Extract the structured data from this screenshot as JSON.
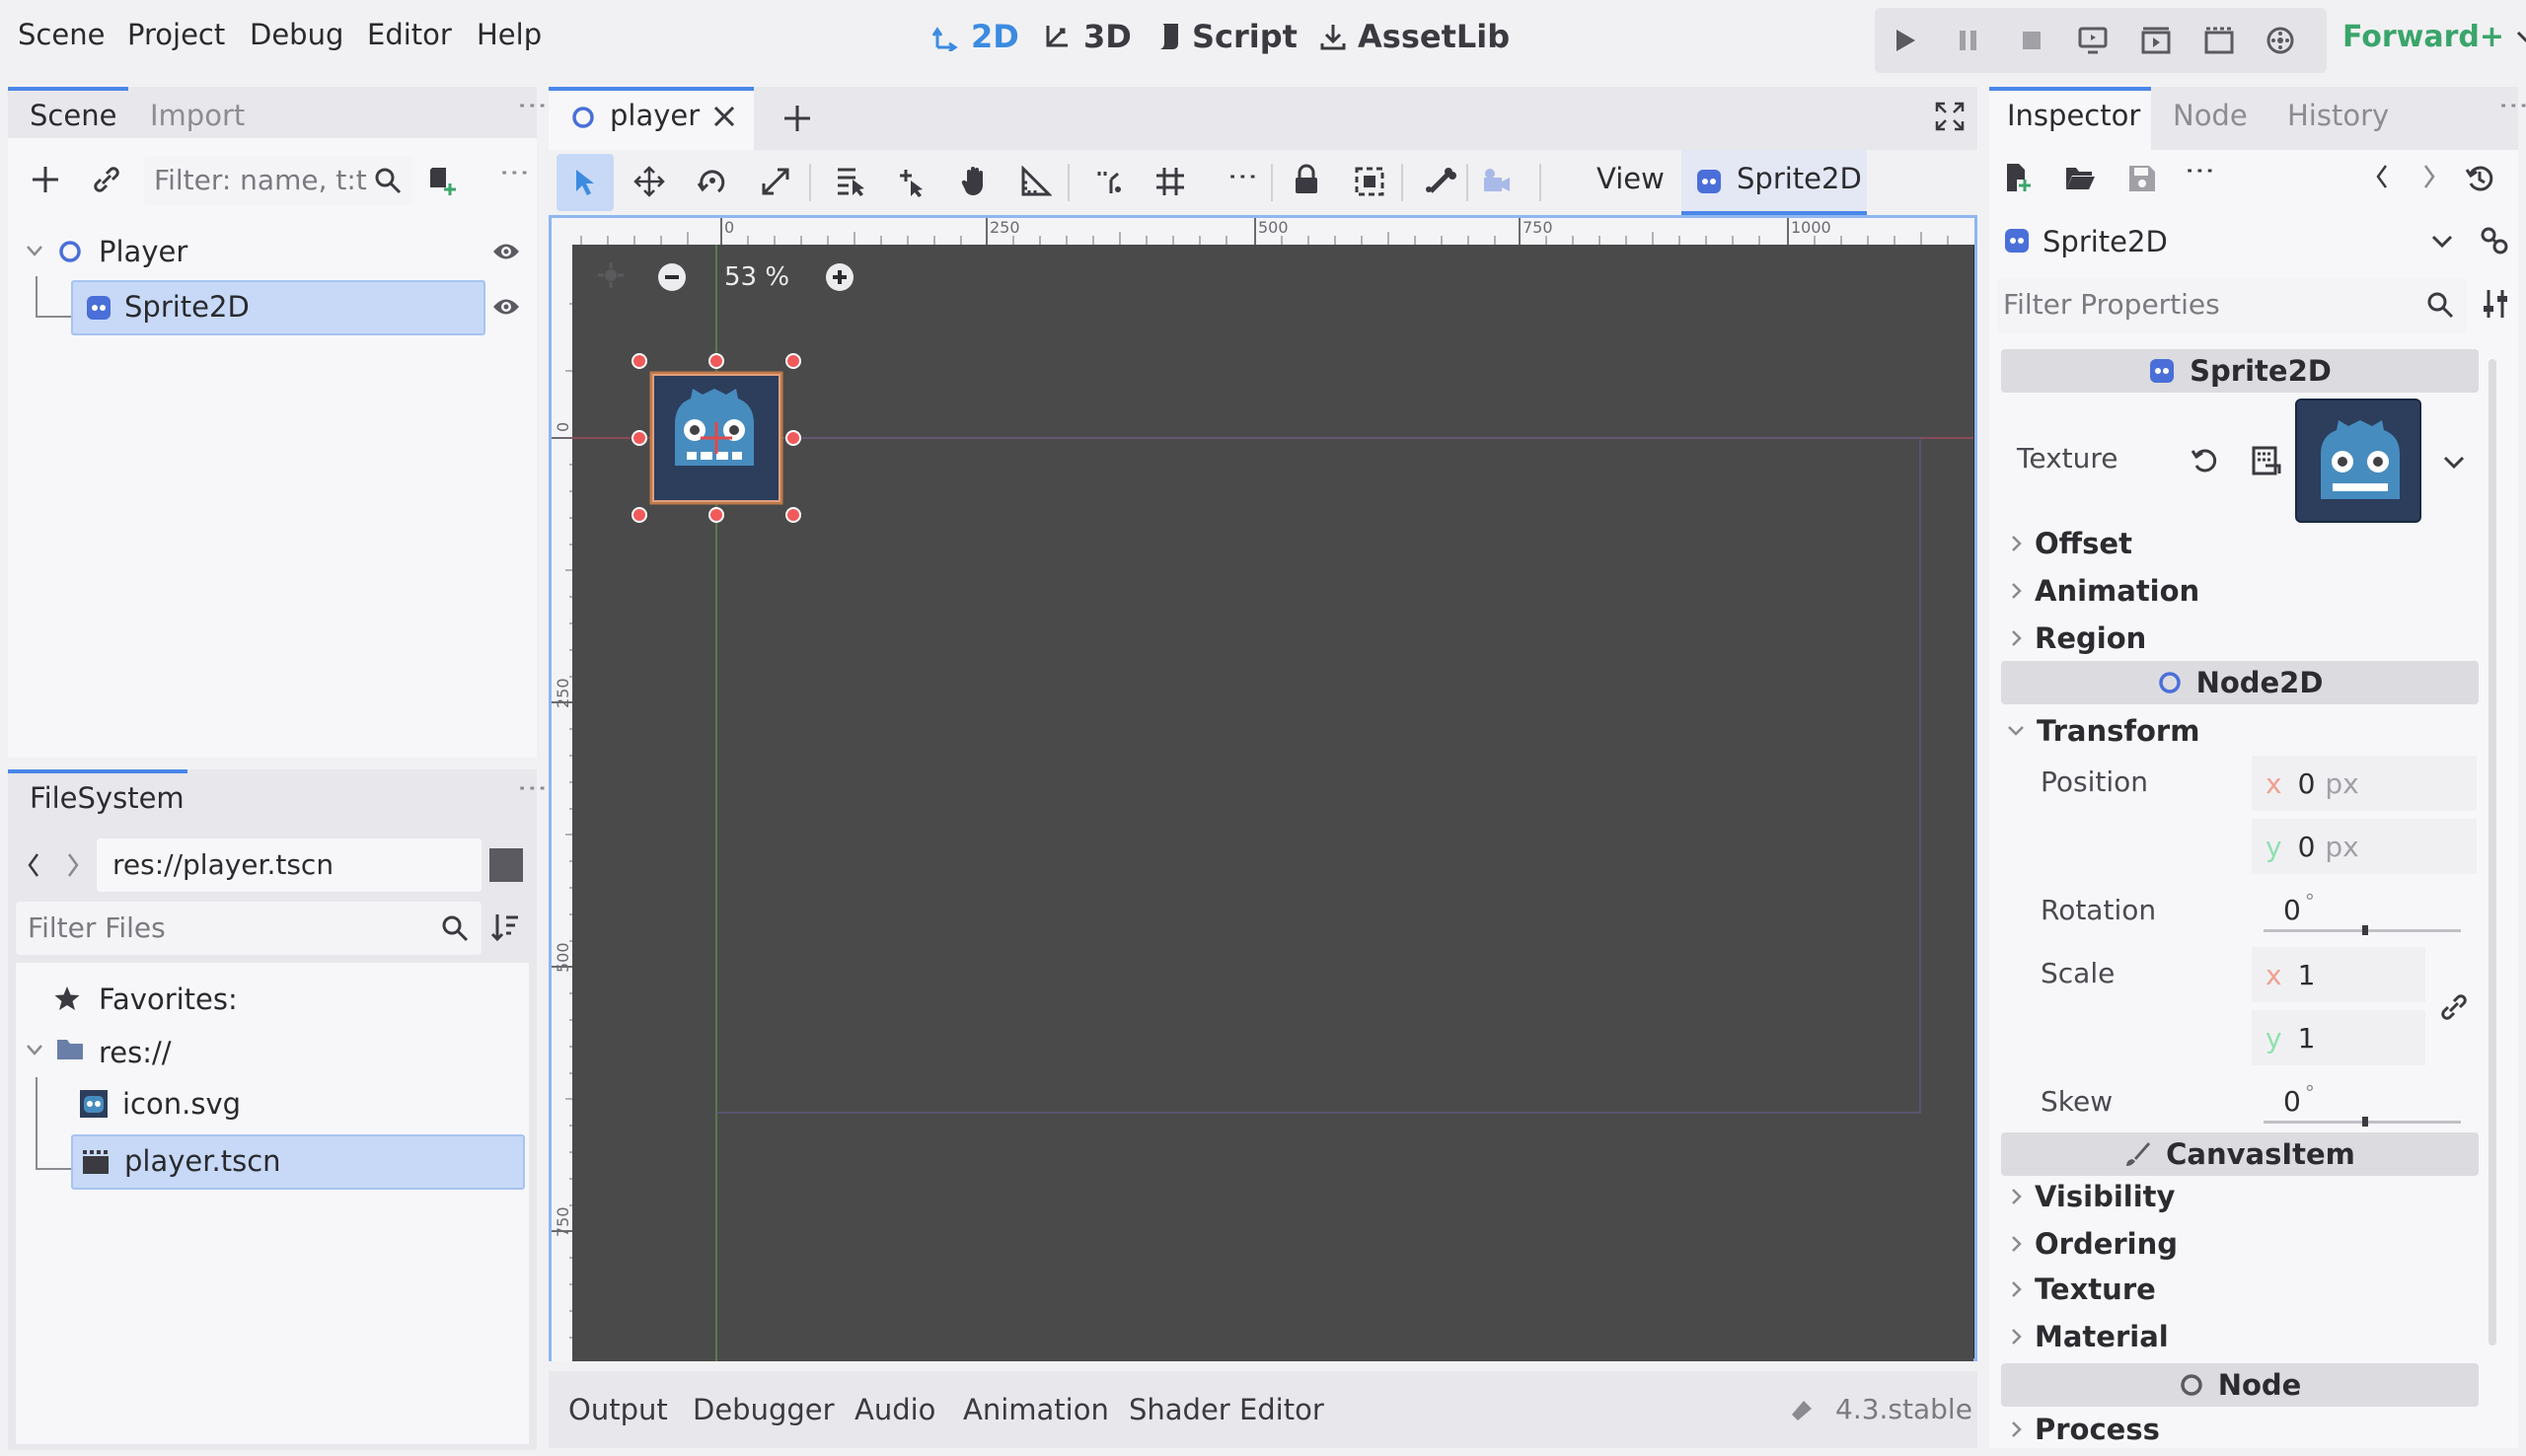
{
  "menu": [
    "Scene",
    "Project",
    "Debug",
    "Editor",
    "Help"
  ],
  "workspaces": {
    "w2d": "2D",
    "w3d": "3D",
    "script": "Script",
    "assetlib": "AssetLib"
  },
  "renderer": "Forward+",
  "scene_panel": {
    "tabs": {
      "scene": "Scene",
      "import": "Import"
    },
    "filter_placeholder": "Filter: name, t:t",
    "tree": {
      "root": "Player",
      "child": "Sprite2D"
    }
  },
  "filesystem": {
    "tab": "FileSystem",
    "path": "res://player.tscn",
    "filter_placeholder": "Filter Files",
    "favorites": "Favorites:",
    "res": "res://",
    "files": {
      "icon": "icon.svg",
      "player": "player.tscn"
    }
  },
  "editor": {
    "scene_tab": "player",
    "view_menu": "View",
    "node_type": "Sprite2D",
    "zoom": "53 %",
    "ruler_h": [
      "0",
      "250",
      "500",
      "750",
      "1000"
    ],
    "ruler_v": [
      "0",
      "250",
      "500",
      "750"
    ]
  },
  "bottom": {
    "tabs": {
      "output": "Output",
      "debugger": "Debugger",
      "audio": "Audio",
      "animation": "Animation",
      "shader": "Shader Editor"
    },
    "version": "4.3.stable"
  },
  "inspector": {
    "tabs": {
      "inspector": "Inspector",
      "node": "Node",
      "history": "History"
    },
    "object": "Sprite2D",
    "filter_placeholder": "Filter Properties",
    "sections": {
      "sprite": "Sprite2D",
      "node2d": "Node2D",
      "canvas": "CanvasItem",
      "node": "Node"
    },
    "texture_label": "Texture",
    "sprite_groups": {
      "offset": "Offset",
      "animation": "Animation",
      "region": "Region"
    },
    "transform": {
      "label": "Transform",
      "position_label": "Position",
      "pos_x": "0",
      "pos_y": "0",
      "unit": "px",
      "rotation_label": "Rotation",
      "rotation": "0",
      "scale_label": "Scale",
      "scale_x": "1",
      "scale_y": "1",
      "skew_label": "Skew",
      "skew": "0",
      "deg": "°"
    },
    "canvas_groups": {
      "visibility": "Visibility",
      "ordering": "Ordering",
      "texture": "Texture",
      "material": "Material"
    },
    "node_groups": {
      "process": "Process"
    }
  },
  "colors": {
    "accent": "#4a86e8",
    "godot_blue": "#478cbf",
    "selection": "#c7d9f7",
    "viewport": "#4a4a4b"
  }
}
